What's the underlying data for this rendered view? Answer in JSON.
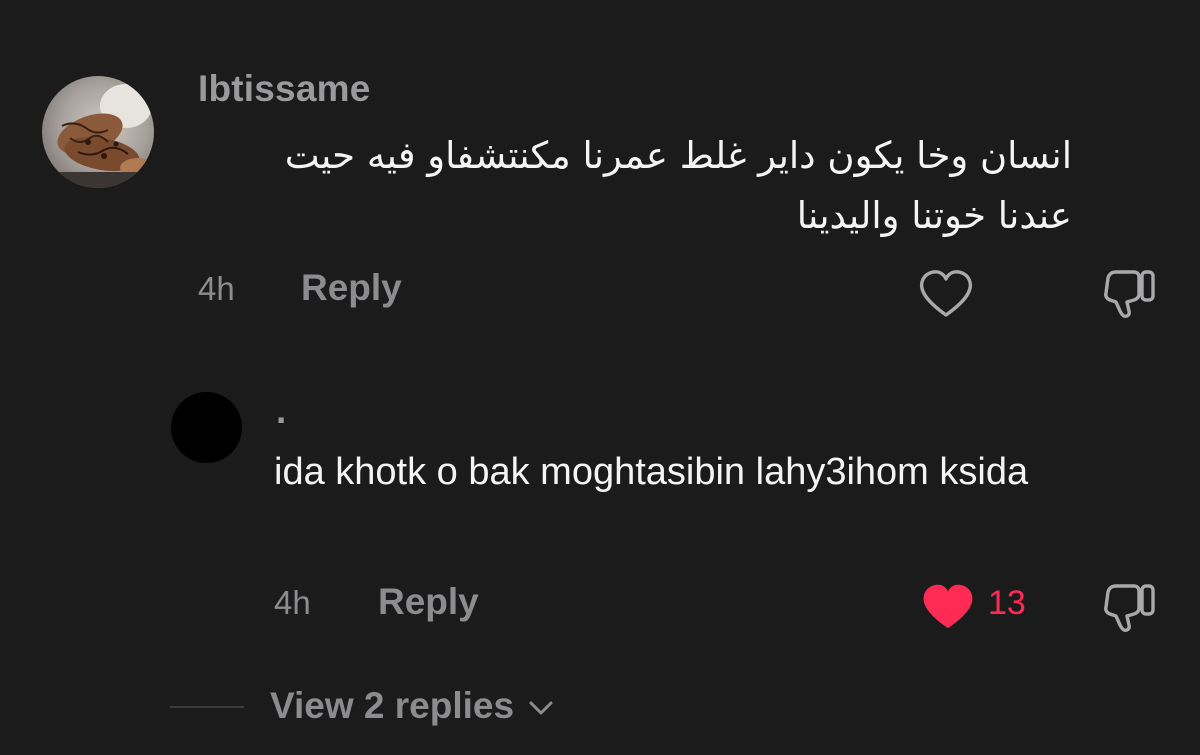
{
  "comments": [
    {
      "username": "Ibtissame",
      "text": "انسان وخا يكون داير غلط عمرنا مكنتشفاو فيه حيت\nعندنا خوتنا واليدينا",
      "time": "4h",
      "reply_label": "Reply",
      "liked": false,
      "icons": {
        "like": "heart-outline-icon",
        "dislike": "thumbs-down-icon"
      }
    },
    {
      "username": ".",
      "text": "ida khotk o bak moghtasibin lahy3ihom ksida",
      "time": "4h",
      "reply_label": "Reply",
      "liked": true,
      "like_count": "13",
      "icons": {
        "like": "heart-filled-icon",
        "dislike": "thumbs-down-icon"
      }
    }
  ],
  "view_replies": {
    "label": "View 2 replies",
    "icon": "chevron-down-icon"
  },
  "colors": {
    "background": "#1b1b1c",
    "muted_text": "#8c8c8e",
    "primary_text": "#f4f4f4",
    "like_active": "#fe2c55"
  }
}
